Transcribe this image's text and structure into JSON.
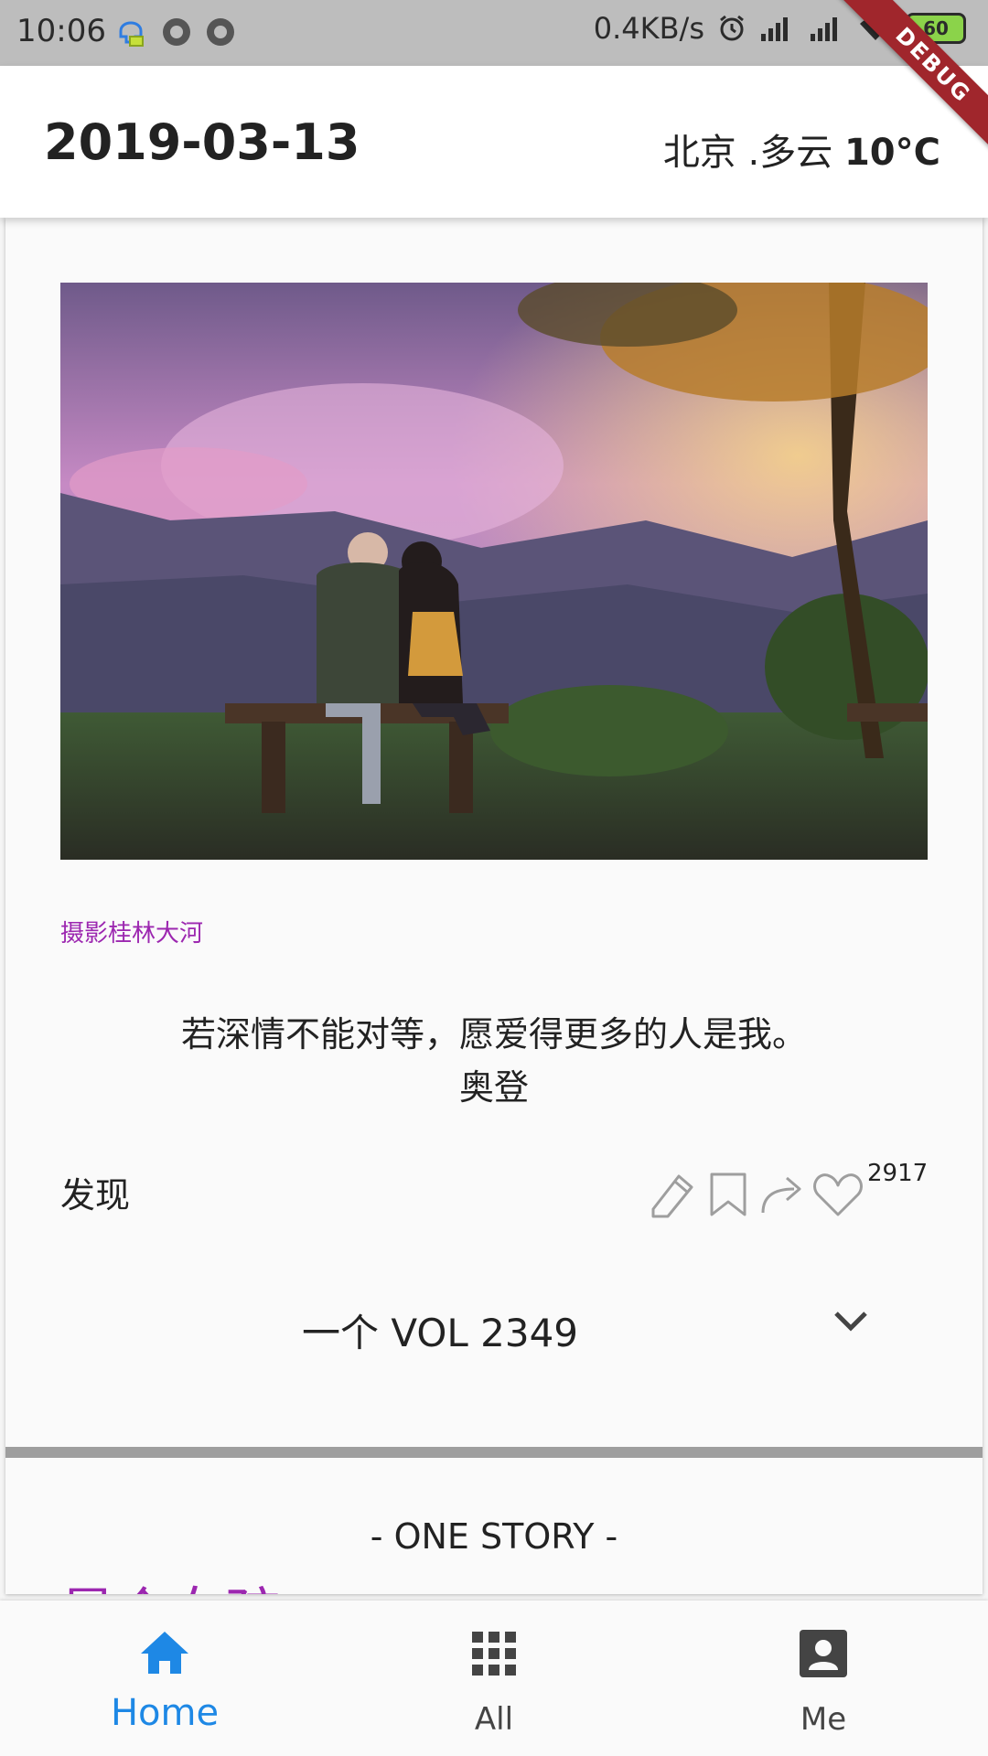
{
  "status_bar": {
    "time": "10:06",
    "speed": "0.4KB/s",
    "battery": "60",
    "debug_label": "DEBUG"
  },
  "header": {
    "date": "2019-03-13",
    "city_weather": "北京 .多云",
    "temperature": "10°C"
  },
  "card": {
    "photo_credit": "摄影桂林大河",
    "quote": "若深情不能对等，愿爱得更多的人是我。",
    "author": "奥登",
    "discover_label": "发现",
    "like_count": "2917",
    "volume": "一个 VOL 2349"
  },
  "story": {
    "header": "- ONE STORY -",
    "title": "是个女孩"
  },
  "bottom_nav": {
    "items": [
      {
        "label": "Home",
        "icon": "home-icon",
        "active": true
      },
      {
        "label": "All",
        "icon": "apps-grid-icon",
        "active": false
      },
      {
        "label": "Me",
        "icon": "account-box-icon",
        "active": false
      }
    ]
  },
  "colors": {
    "accent_blue": "#1e88e5",
    "purple": "#9c27b0",
    "status_bar": "#bdbdbd",
    "divider": "#9e9e9e"
  }
}
